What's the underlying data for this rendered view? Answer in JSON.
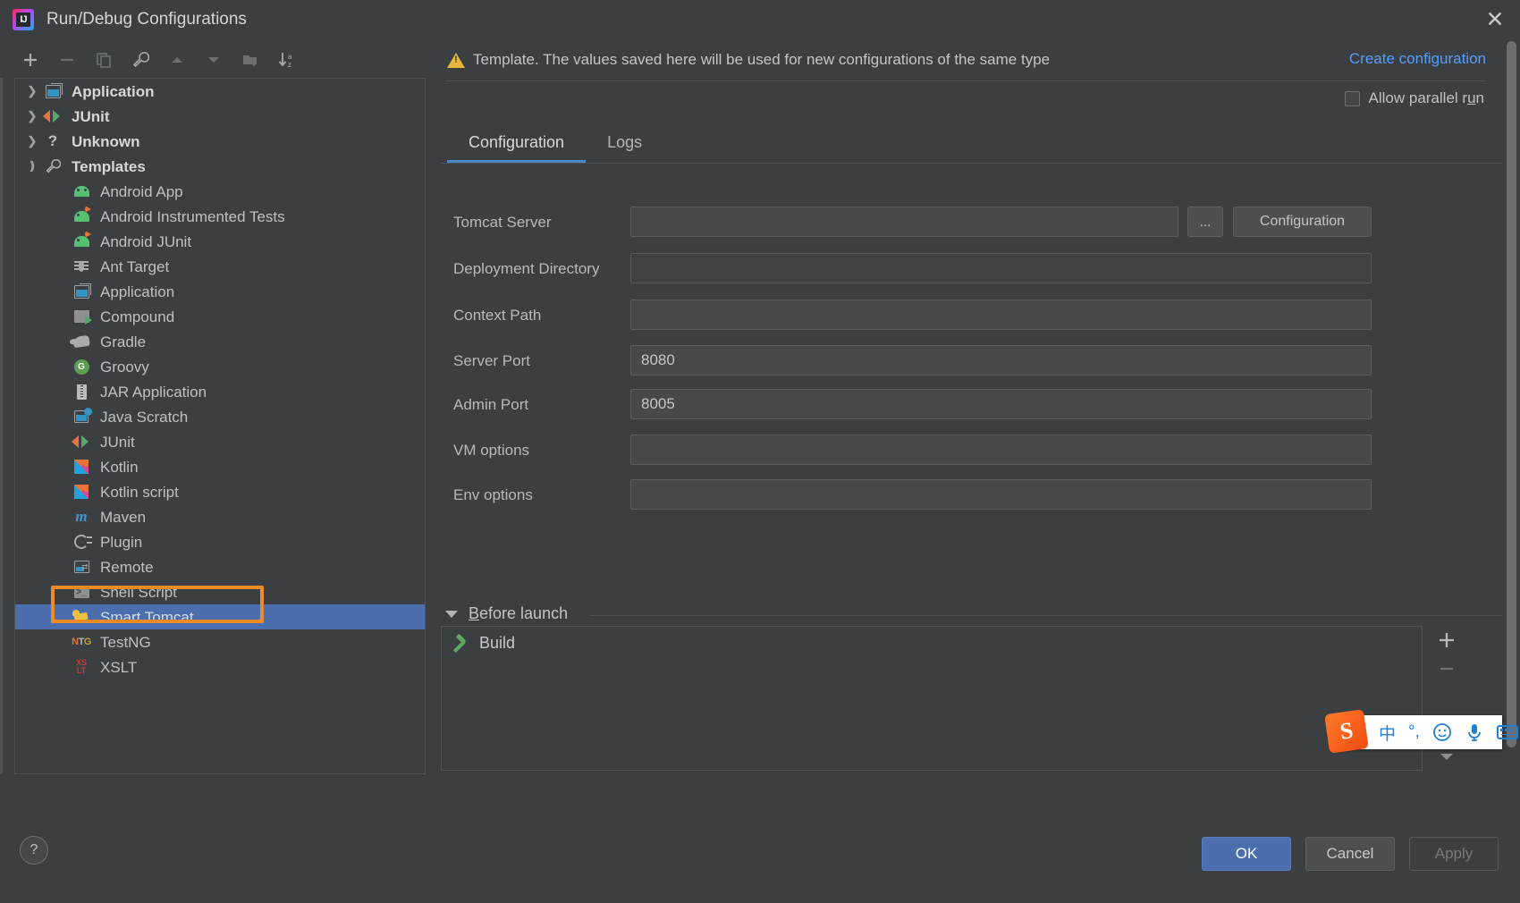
{
  "window": {
    "title": "Run/Debug Configurations",
    "app_icon": "intellij-idea-icon",
    "close_label": "✕"
  },
  "toolbar": {
    "buttons": [
      {
        "name": "add-configuration-button",
        "icon": "plus-icon",
        "enabled": true
      },
      {
        "name": "remove-configuration-button",
        "icon": "minus-icon",
        "enabled": false
      },
      {
        "name": "copy-configuration-button",
        "icon": "copy-icon",
        "enabled": false
      },
      {
        "name": "edit-templates-button",
        "icon": "wrench-icon",
        "enabled": true
      },
      {
        "name": "move-up-button",
        "icon": "arrow-up-icon",
        "enabled": false
      },
      {
        "name": "move-down-button",
        "icon": "arrow-down-icon",
        "enabled": false
      },
      {
        "name": "new-folder-button",
        "icon": "folder-add-icon",
        "enabled": false
      },
      {
        "name": "sort-alphabetically-button",
        "icon": "sort-az-icon",
        "enabled": true
      }
    ]
  },
  "tree": {
    "groups": [
      {
        "label": "Application",
        "icon": "application-icon",
        "expanded": false
      },
      {
        "label": "JUnit",
        "icon": "junit-icon",
        "expanded": false
      },
      {
        "label": "Unknown",
        "icon": "question-icon",
        "expanded": false
      },
      {
        "label": "Templates",
        "icon": "wrench-icon",
        "expanded": true
      }
    ],
    "templates": [
      {
        "label": "Android App",
        "icon": "android-icon"
      },
      {
        "label": "Android Instrumented Tests",
        "icon": "android-test-icon"
      },
      {
        "label": "Android JUnit",
        "icon": "android-test-icon"
      },
      {
        "label": "Ant Target",
        "icon": "ant-icon"
      },
      {
        "label": "Application",
        "icon": "application-icon"
      },
      {
        "label": "Compound",
        "icon": "compound-icon"
      },
      {
        "label": "Gradle",
        "icon": "gradle-icon"
      },
      {
        "label": "Groovy",
        "icon": "groovy-icon"
      },
      {
        "label": "JAR Application",
        "icon": "jar-icon"
      },
      {
        "label": "Java Scratch",
        "icon": "java-scratch-icon"
      },
      {
        "label": "JUnit",
        "icon": "junit-icon"
      },
      {
        "label": "Kotlin",
        "icon": "kotlin-icon"
      },
      {
        "label": "Kotlin script",
        "icon": "kotlin-icon"
      },
      {
        "label": "Maven",
        "icon": "maven-icon"
      },
      {
        "label": "Plugin",
        "icon": "plugin-icon"
      },
      {
        "label": "Remote",
        "icon": "remote-icon"
      },
      {
        "label": "Shell Script",
        "icon": "shell-script-icon"
      },
      {
        "label": "Smart Tomcat",
        "icon": "tomcat-icon",
        "selected": true
      },
      {
        "label": "TestNG",
        "icon": "testng-icon"
      },
      {
        "label": "XSLT",
        "icon": "xslt-icon"
      }
    ],
    "selected": "Smart Tomcat"
  },
  "notice": {
    "icon": "warning-icon",
    "text": "Template. The values saved here will be used for new configurations of the same type",
    "create_link": "Create configuration"
  },
  "parallel": {
    "label_prefix": "Allow parallel r",
    "label_mnemonic": "u",
    "label_suffix": "n",
    "checked": false
  },
  "tabs": [
    {
      "label": "Configuration",
      "active": true
    },
    {
      "label": "Logs",
      "active": false
    }
  ],
  "form": {
    "fields": [
      {
        "label": "Tomcat Server",
        "value": "",
        "type": "combo",
        "enabled": true
      },
      {
        "label": "Deployment Directory",
        "value": "",
        "type": "text-with-folder",
        "enabled": false,
        "trailing_icon": "folder-icon"
      },
      {
        "label": "Context Path",
        "value": "",
        "type": "text",
        "enabled": true
      },
      {
        "label": "Server Port",
        "value": "8080",
        "type": "text",
        "enabled": true
      },
      {
        "label": "Admin Port",
        "value": "8005",
        "type": "text",
        "enabled": true
      },
      {
        "label": "VM options",
        "value": "",
        "type": "text-with-expand",
        "enabled": true,
        "trailing_icon": "expand-icon"
      },
      {
        "label": "Env options",
        "value": "",
        "type": "text-with-list",
        "enabled": true,
        "trailing_icon": "env-list-icon"
      }
    ],
    "browse_button": "...",
    "configuration_button": "Configuration"
  },
  "before_launch": {
    "title_mnemonic": "B",
    "title_rest": "efore launch",
    "expanded": true,
    "items": [
      {
        "label": "Build",
        "icon": "hammer-icon"
      }
    ],
    "side_buttons": [
      {
        "name": "add-task-button",
        "icon": "plus-icon",
        "enabled": true
      },
      {
        "name": "remove-task-button",
        "icon": "minus-icon",
        "enabled": false
      },
      {
        "name": "move-task-up-button",
        "icon": "arrow-up-icon",
        "enabled": false
      },
      {
        "name": "move-task-down-button",
        "icon": "arrow-down-icon",
        "enabled": false
      }
    ]
  },
  "ime": {
    "logo": "sogou-logo",
    "items": [
      {
        "name": "ime-language-toggle",
        "glyph": "中"
      },
      {
        "name": "ime-punctuation-toggle",
        "glyph": "°,"
      },
      {
        "name": "ime-emoji-button",
        "glyph": "☺"
      },
      {
        "name": "ime-voice-input-button",
        "glyph": "🎤"
      },
      {
        "name": "ime-soft-keyboard-button",
        "glyph": "keyboard-icon"
      }
    ]
  },
  "footer": {
    "help": "?",
    "ok": "OK",
    "cancel": "Cancel",
    "apply": "Apply",
    "apply_enabled": false
  },
  "colors": {
    "accent_blue": "#4b6eaf",
    "link_blue": "#589df6",
    "tab_underline": "#4a88c7",
    "warning_yellow": "#e8b63a",
    "annotation_orange": "#f08a24",
    "selection_blue": "#4b6eaf",
    "background": "#3c3f41",
    "field_background": "#45494a"
  }
}
